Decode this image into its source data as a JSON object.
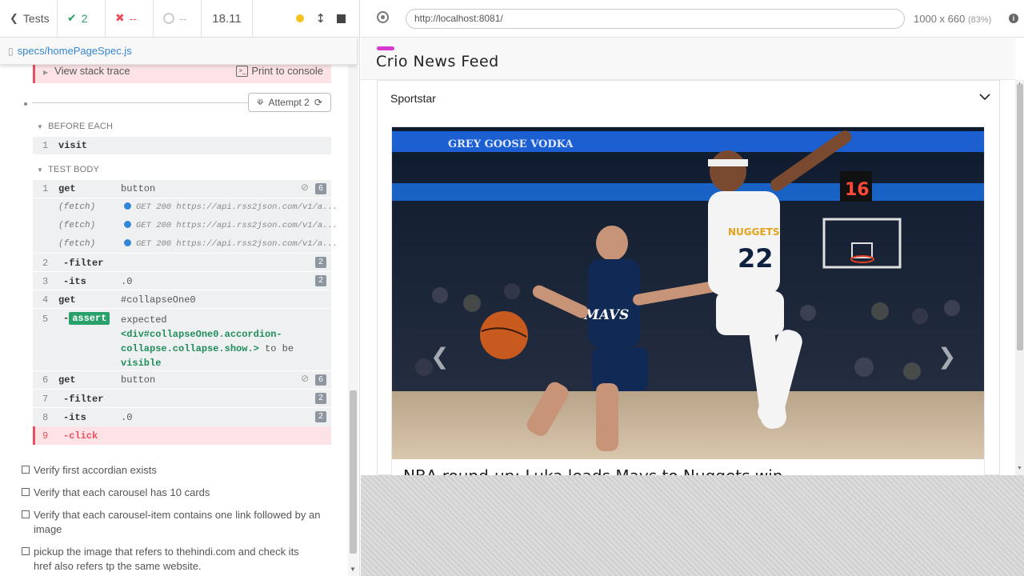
{
  "runner": {
    "tests_label": "Tests",
    "passed_count": "2",
    "failed_count": "--",
    "pending_count": "--",
    "duration": "18.11",
    "spec_path": "specs/homePageSpec.js",
    "view_stack_trace": "View stack trace",
    "print_to_console": "Print to console",
    "attempt_label": "Attempt 2",
    "before_each_label": "BEFORE EACH",
    "test_body_label": "TEST BODY",
    "before_each_commands": [
      {
        "num": "1",
        "name": "visit",
        "msg": ""
      }
    ],
    "commands": [
      {
        "num": "1",
        "name": "get",
        "msg": "button",
        "badge": "6"
      },
      {
        "num": "",
        "name": "(fetch)",
        "msg": "GET 200 https://api.rss2json.com/v1/a..."
      },
      {
        "num": "",
        "name": "(fetch)",
        "msg": "GET 200 https://api.rss2json.com/v1/a..."
      },
      {
        "num": "",
        "name": "(fetch)",
        "msg": "GET 200 https://api.rss2json.com/v1/a..."
      },
      {
        "num": "2",
        "name": "-filter",
        "msg": "",
        "badge": "2"
      },
      {
        "num": "3",
        "name": "-its",
        "msg": ".0",
        "badge": "2"
      },
      {
        "num": "4",
        "name": "get",
        "msg": "#collapseOne0"
      },
      {
        "num": "5",
        "name": "-",
        "tag": "assert",
        "msg_parts": [
          "expected",
          "<div#collapseOne0.accordion-",
          "collapse.collapse.show.>",
          "to be",
          "visible"
        ]
      },
      {
        "num": "6",
        "name": "get",
        "msg": "button",
        "badge": "6"
      },
      {
        "num": "7",
        "name": "-filter",
        "msg": "",
        "badge": "2"
      },
      {
        "num": "8",
        "name": "-its",
        "msg": ".0",
        "badge": "2"
      },
      {
        "num": "9",
        "name": "-click",
        "msg": ""
      }
    ],
    "tests": [
      "Verify first accordian exists",
      "Verify that each carousel has 10 cards",
      "Verify that each carousel-item contains one link followed by an image",
      "pickup the image that refers to thehindi.com and check its href also refers tp the same website."
    ]
  },
  "browser": {
    "url": "http://localhost:8081/",
    "viewport": "1000 x 660",
    "scale": "(83%)"
  },
  "app": {
    "brand": "Crio News Feed",
    "accordion_title": "Sportstar",
    "headline": "NBA round-up: Luka leads Mavs to Nuggets win",
    "photo_text": {
      "jersey_left": "MAVS",
      "jersey_right": "NUGGETS",
      "number": "22",
      "banner": "GREY GOOSE VODKA",
      "clock": "16"
    }
  }
}
